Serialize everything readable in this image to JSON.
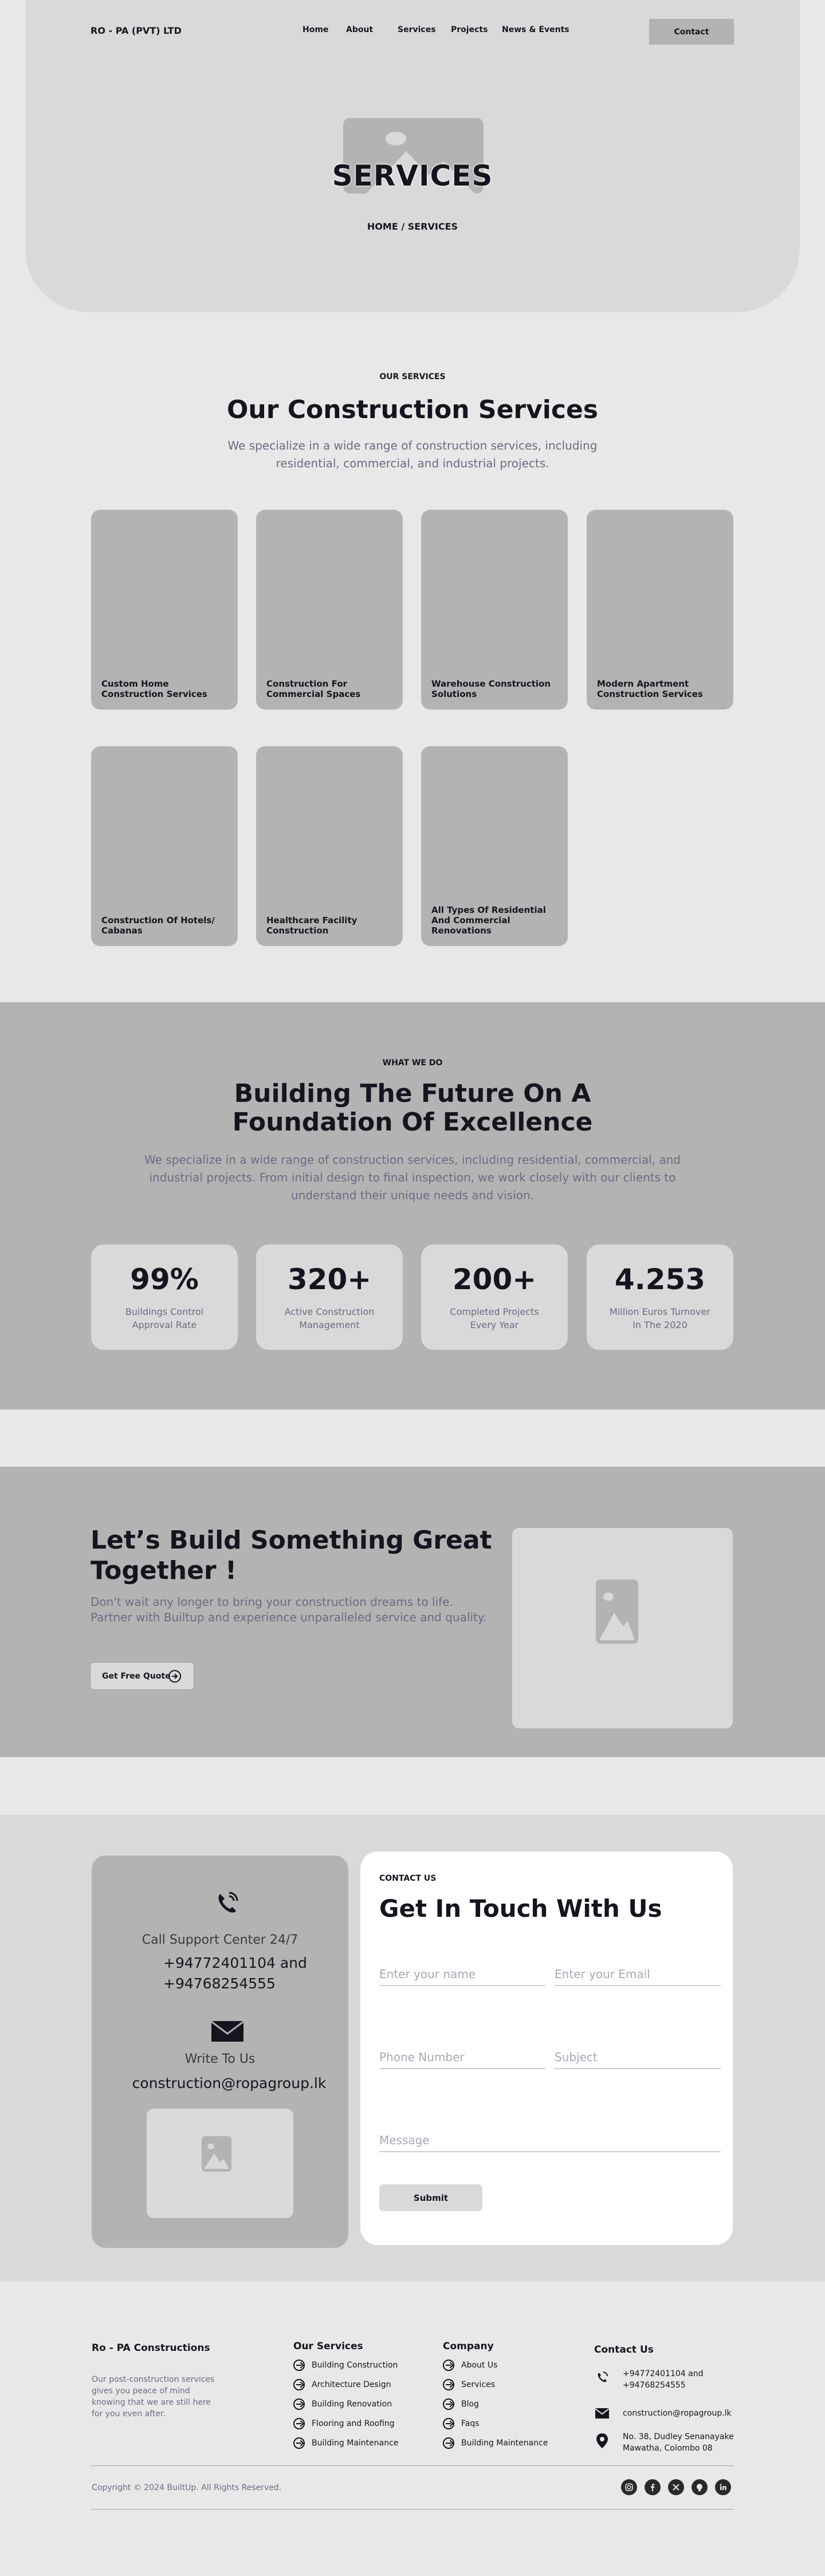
{
  "header": {
    "logo": "RO - PA  (PVT) LTD",
    "nav": [
      "Home",
      "About",
      "Services",
      "Projects",
      "News & Events"
    ],
    "contact_button": "Contact"
  },
  "hero": {
    "title": "SERVICES",
    "breadcrumb": "HOME / SERVICES"
  },
  "services": {
    "eyebrow": "OUR SERVICES",
    "title": "Our Construction Services",
    "subtitle": "We specialize in a wide range of construction services, including residential, commercial, and industrial projects.",
    "cards": [
      "Custom Home Construction Services",
      "Construction For Commercial Spaces",
      "Warehouse Construction Solutions",
      "Modern Apartment Construction Services",
      "Construction Of Hotels/ Cabanas",
      "Healthcare Facility Construction",
      "All Types Of Residential And Commercial Renovations"
    ]
  },
  "whatwedo": {
    "eyebrow": "WHAT WE DO",
    "title": "Building The Future On A Foundation Of Excellence",
    "subtitle": "We specialize in a wide range of construction services, including residential, commercial, and industrial projects. From initial design to final inspection, we work closely with our clients to understand their unique needs and vision.",
    "stats": [
      {
        "value": "99%",
        "label": "Buildings Control Approval Rate"
      },
      {
        "value": "320+",
        "label": "Active Construction Management"
      },
      {
        "value": "200+",
        "label": "Completed Projects Every Year"
      },
      {
        "value": "4.253",
        "label": "Million Euros Turnover In The 2020"
      }
    ]
  },
  "cta": {
    "title": "Let’s Build Something Great Together !",
    "text": "Don't wait any longer to bring your construction dreams to life. Partner with Builtup and experience unparalleled service and quality.",
    "button": "Get Free Quote"
  },
  "contact": {
    "support_label": "Call Support Center 24/7",
    "phones": "+94772401104 and +94768254555",
    "write_label": "Write To Us",
    "email": "construction@ropagroup.lk",
    "eyebrow": "CONTACT US",
    "title": "Get In Touch With Us",
    "placeholders": {
      "name": "Enter your name",
      "email": "Enter your Email",
      "phone": "Phone Number",
      "subject": "Subject",
      "message": "Message"
    },
    "submit": "Submit"
  },
  "footer": {
    "brand": "Ro - PA Constructions",
    "about": "Our post-construction services gives you peace of mind knowing that we are still here for you even after.",
    "services_title": "Our Services",
    "services": [
      "Building Construction",
      "Architecture Design",
      "Building Renovation",
      "Flooring and Roofing",
      "Building Maintenance"
    ],
    "company_title": "Company",
    "company": [
      "About Us",
      "Services",
      "Blog",
      "Faqs",
      "Building Maintenance"
    ],
    "contact_title": "Contact Us",
    "phone": "+94772401104 and +94768254555",
    "email": "construction@ropagroup.lk",
    "address": "No. 38, Dudley Senanayake Mawatha, Colombo 08",
    "copyright": "Copyright © 2024 BuiltUp. All Rights Reserved.",
    "social": [
      "instagram-icon",
      "facebook-icon",
      "x-icon",
      "github-icon",
      "linkedin-icon"
    ]
  },
  "colors": {
    "page_bg": "#e8e8e8",
    "hero_bg": "#d9d9d9",
    "block_grey": "#b3b3b3",
    "text_dark": "#15151f",
    "text_muted": "#6b6b85"
  }
}
